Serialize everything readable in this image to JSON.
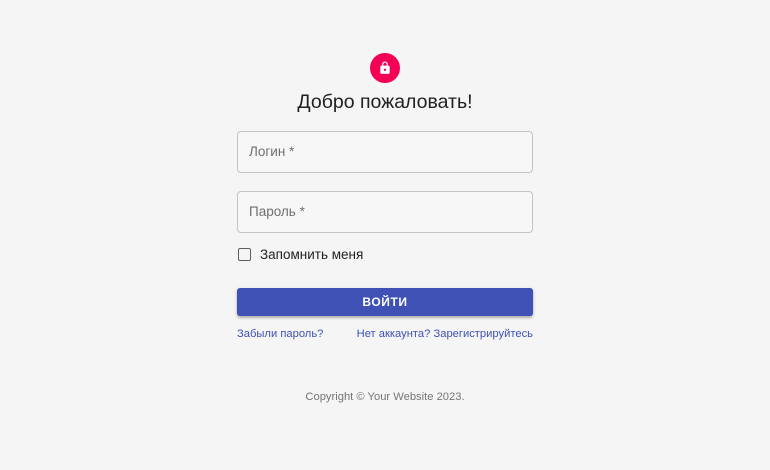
{
  "header": {
    "title": "Добро пожаловать!",
    "avatar_icon": "lock-icon",
    "avatar_color": "#f50057"
  },
  "form": {
    "login_field": {
      "label": "Логин *",
      "value": ""
    },
    "password_field": {
      "label": "Пароль *",
      "value": ""
    },
    "remember_me": {
      "label": "Запомнить меня",
      "checked": false
    },
    "submit_label": "ВОЙТИ",
    "submit_color": "#3f51b5"
  },
  "links": {
    "forgot_password": "Забыли пароль?",
    "register": "Нет аккаунта? Зарегистрируйтесь"
  },
  "footer": {
    "copyright": "Copyright © Your Website 2023."
  }
}
